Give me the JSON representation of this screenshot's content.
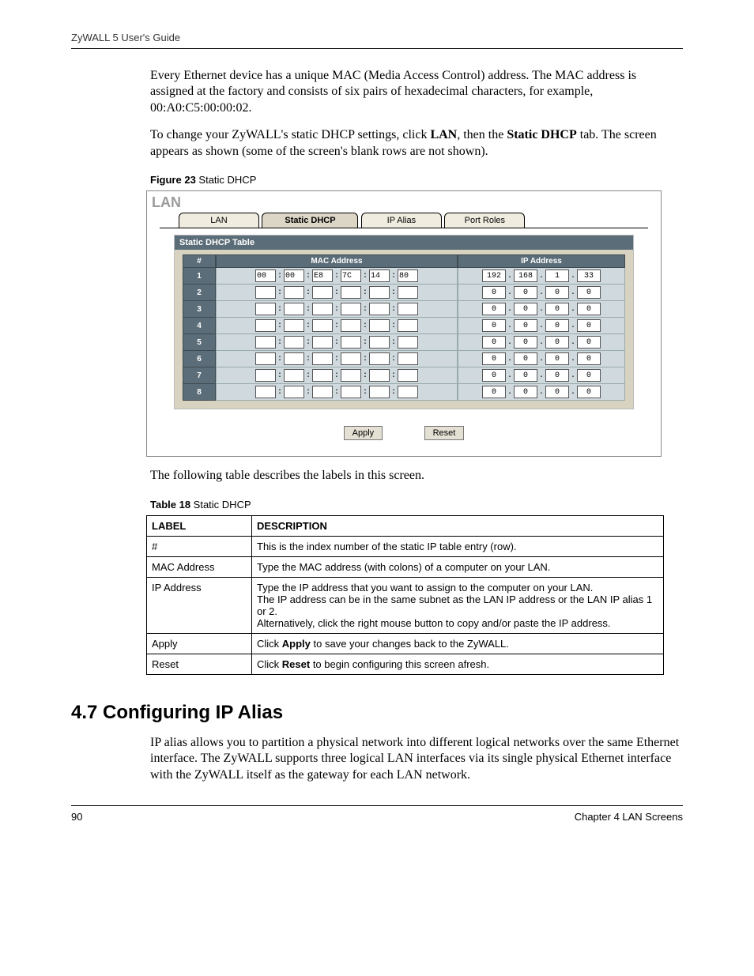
{
  "header": {
    "title": "ZyWALL 5 User's Guide"
  },
  "intro": {
    "p1_a": "Every Ethernet device has a unique MAC (Media Access Control) address. The MAC address is assigned at the factory and consists of six pairs of hexadecimal characters, for example, 00:A0:C5:00:00:02.",
    "p2_a": "To change your ZyWALL's static DHCP settings, click ",
    "p2_b": "LAN",
    "p2_c": ", then the ",
    "p2_d": "Static DHCP",
    "p2_e": " tab. The screen appears as shown (some of the screen's blank rows are not shown)."
  },
  "figure": {
    "caption_bold": "Figure 23",
    "caption_rest": "   Static DHCP",
    "lan_label": "LAN",
    "tabs": {
      "lan": "LAN",
      "static": "Static DHCP",
      "ipalias": "IP Alias",
      "port": "Port Roles"
    },
    "section_bar": "Static DHCP Table",
    "cols": {
      "idx": "#",
      "mac": "MAC Address",
      "ip": "IP Address"
    },
    "rows": [
      {
        "n": "1",
        "mac": [
          "00",
          "00",
          "E8",
          "7C",
          "14",
          "80"
        ],
        "ip": [
          "192",
          "168",
          "1",
          "33"
        ]
      },
      {
        "n": "2",
        "mac": [
          "",
          "",
          "",
          "",
          "",
          ""
        ],
        "ip": [
          "0",
          "0",
          "0",
          "0"
        ]
      },
      {
        "n": "3",
        "mac": [
          "",
          "",
          "",
          "",
          "",
          ""
        ],
        "ip": [
          "0",
          "0",
          "0",
          "0"
        ]
      },
      {
        "n": "4",
        "mac": [
          "",
          "",
          "",
          "",
          "",
          ""
        ],
        "ip": [
          "0",
          "0",
          "0",
          "0"
        ]
      },
      {
        "n": "5",
        "mac": [
          "",
          "",
          "",
          "",
          "",
          ""
        ],
        "ip": [
          "0",
          "0",
          "0",
          "0"
        ]
      },
      {
        "n": "6",
        "mac": [
          "",
          "",
          "",
          "",
          "",
          ""
        ],
        "ip": [
          "0",
          "0",
          "0",
          "0"
        ]
      },
      {
        "n": "7",
        "mac": [
          "",
          "",
          "",
          "",
          "",
          ""
        ],
        "ip": [
          "0",
          "0",
          "0",
          "0"
        ]
      },
      {
        "n": "8",
        "mac": [
          "",
          "",
          "",
          "",
          "",
          ""
        ],
        "ip": [
          "0",
          "0",
          "0",
          "0"
        ]
      }
    ],
    "buttons": {
      "apply": "Apply",
      "reset": "Reset"
    }
  },
  "after_fig": "The following table describes the labels in this screen.",
  "table18": {
    "caption_bold": "Table 18",
    "caption_rest": "   Static DHCP",
    "head": {
      "label": "LABEL",
      "desc": "DESCRIPTION"
    },
    "rows": {
      "r1l": "#",
      "r1d": "This is the index number of the static IP table entry (row).",
      "r2l": "MAC Address",
      "r2d": "Type the MAC address (with colons) of a computer on your LAN.",
      "r3l": "IP Address",
      "r3d1": "Type the IP address that you want to assign to the computer on your LAN.",
      "r3d2": "The IP address can be in the same subnet as the LAN IP address or the LAN IP alias 1 or 2.",
      "r3d3": "Alternatively, click the right mouse button to copy and/or paste the IP address.",
      "r4l": "Apply",
      "r4d_a": "Click ",
      "r4d_b": "Apply",
      "r4d_c": " to save your changes back to the ZyWALL.",
      "r5l": "Reset",
      "r5d_a": "Click ",
      "r5d_b": "Reset",
      "r5d_c": " to begin configuring this screen afresh."
    }
  },
  "section": {
    "heading": "4.7  Configuring IP Alias",
    "p1": "IP alias allows you to partition a physical network into different logical networks over the same Ethernet interface. The ZyWALL supports three logical LAN interfaces via its single physical Ethernet interface with the ZyWALL itself as the gateway for each LAN network."
  },
  "footer": {
    "page": "90",
    "chapter": "Chapter 4 LAN Screens"
  }
}
